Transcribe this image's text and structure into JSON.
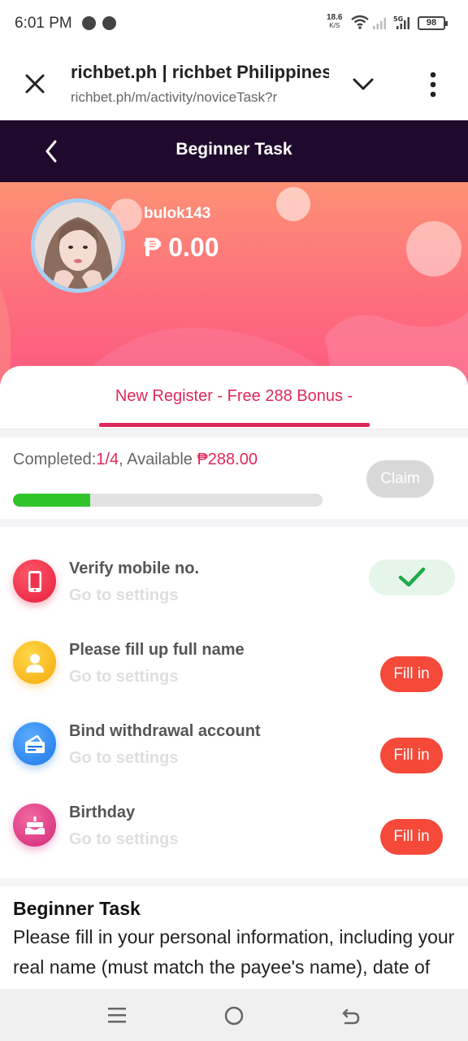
{
  "status_bar": {
    "time": "6:01 PM",
    "speed_value": "18.6",
    "speed_unit": "K/S",
    "network": "5G",
    "battery": "98"
  },
  "browser": {
    "title": "richbet.ph | richbet Philippines",
    "url": "richbet.ph/m/activity/noviceTask?r"
  },
  "header": {
    "title": "Beginner Task"
  },
  "profile": {
    "username": "bulok143",
    "balance": "₱ 0.00"
  },
  "tab": {
    "label": "New Register - Free 288 Bonus -"
  },
  "progress": {
    "completed_label": "Completed:",
    "completed_value": "1/4",
    "available_label": ", Available ",
    "available_value": "₱288.00",
    "fraction": 0.25,
    "claim_label": "Claim"
  },
  "tasks": [
    {
      "name": "Verify mobile no.",
      "sub": "Go to settings",
      "status": "done",
      "icon": "phone-icon",
      "color": "#f0334d"
    },
    {
      "name": "Please fill up full name",
      "sub": "Go to settings",
      "status": "pending",
      "action": "Fill in",
      "icon": "user-icon",
      "color": "#fbb41a"
    },
    {
      "name": "Bind withdrawal account",
      "sub": "Go to settings",
      "status": "pending",
      "action": "Fill in",
      "icon": "card-icon",
      "color": "#2f8ef0"
    },
    {
      "name": "Birthday",
      "sub": "Go to settings",
      "status": "pending",
      "action": "Fill in",
      "icon": "cake-icon",
      "color": "#e0407f"
    }
  ],
  "description": {
    "title": "Beginner Task",
    "text": "Please fill in your personal information, including your real name (must match the payee's name), date of birth and verify your phone number."
  },
  "colors": {
    "accent": "#e0285b",
    "header_bg": "#1f0a2e",
    "progress": "#30c42a",
    "action": "#f5493a"
  }
}
